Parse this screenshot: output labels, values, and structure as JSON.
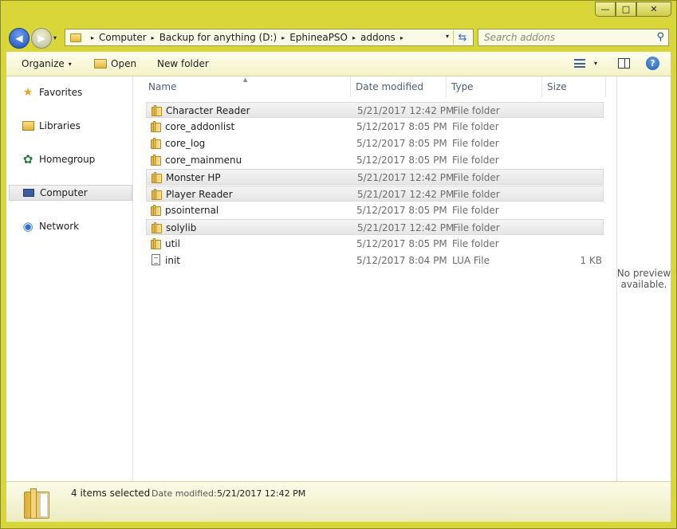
{
  "window": {
    "caption_buttons": {
      "minimize": "—",
      "maximize": "□",
      "close": "✕"
    }
  },
  "nav": {
    "back_glyph": "◀",
    "forward_glyph": "▶",
    "history_glyph": "▾"
  },
  "address": {
    "crumbs": [
      "Computer",
      "Backup for anything (D:)",
      "EphineaPSO",
      "addons"
    ],
    "separator": "▸",
    "dropdown_glyph": "▾",
    "refresh_glyph": "⇆"
  },
  "search": {
    "placeholder": "Search addons",
    "icon_glyph": "⚲"
  },
  "toolbar": {
    "organize": "Organize",
    "open": "Open",
    "new_folder": "New folder",
    "dropdown_glyph": "▾",
    "help": "?"
  },
  "sidebar": {
    "items": [
      {
        "label": "Favorites",
        "icon": "star-icon",
        "glyph": "★"
      },
      {
        "label": "Libraries",
        "icon": "libraries-icon",
        "glyph": ""
      },
      {
        "label": "Homegroup",
        "icon": "homegroup-icon",
        "glyph": "✿"
      },
      {
        "label": "Computer",
        "icon": "computer-icon",
        "glyph": "",
        "selected": true
      },
      {
        "label": "Network",
        "icon": "network-icon",
        "glyph": "◉"
      }
    ]
  },
  "columns": {
    "name": "Name",
    "date": "Date modified",
    "type": "Type",
    "size": "Size",
    "sort_glyph": "▲"
  },
  "files": [
    {
      "name": "Character Reader",
      "date": "5/21/2017 12:42 PM",
      "type": "File folder",
      "size": "",
      "kind": "folder",
      "selected": true
    },
    {
      "name": "core_addonlist",
      "date": "5/12/2017 8:05 PM",
      "type": "File folder",
      "size": "",
      "kind": "folder",
      "selected": false
    },
    {
      "name": "core_log",
      "date": "5/12/2017 8:05 PM",
      "type": "File folder",
      "size": "",
      "kind": "folder",
      "selected": false
    },
    {
      "name": "core_mainmenu",
      "date": "5/12/2017 8:05 PM",
      "type": "File folder",
      "size": "",
      "kind": "folder",
      "selected": false
    },
    {
      "name": "Monster HP",
      "date": "5/21/2017 12:42 PM",
      "type": "File folder",
      "size": "",
      "kind": "folder",
      "selected": true
    },
    {
      "name": "Player Reader",
      "date": "5/21/2017 12:42 PM",
      "type": "File folder",
      "size": "",
      "kind": "folder",
      "selected": true
    },
    {
      "name": "psointernal",
      "date": "5/12/2017 8:05 PM",
      "type": "File folder",
      "size": "",
      "kind": "folder",
      "selected": false
    },
    {
      "name": "solylib",
      "date": "5/21/2017 12:42 PM",
      "type": "File folder",
      "size": "",
      "kind": "folder",
      "selected": true
    },
    {
      "name": "util",
      "date": "5/12/2017 8:05 PM",
      "type": "File folder",
      "size": "",
      "kind": "folder",
      "selected": false
    },
    {
      "name": "init",
      "date": "5/12/2017 8:04 PM",
      "type": "LUA File",
      "size": "1 KB",
      "kind": "file",
      "selected": false
    }
  ],
  "preview": {
    "text": "No preview available."
  },
  "status": {
    "count": "4 items selected",
    "date_label": "Date modified:",
    "date_value": "5/21/2017 12:42 PM"
  },
  "colors": {
    "frame": "#d9d63a",
    "selection": "#e8e8e8",
    "link_blue": "#2d6bd0"
  }
}
